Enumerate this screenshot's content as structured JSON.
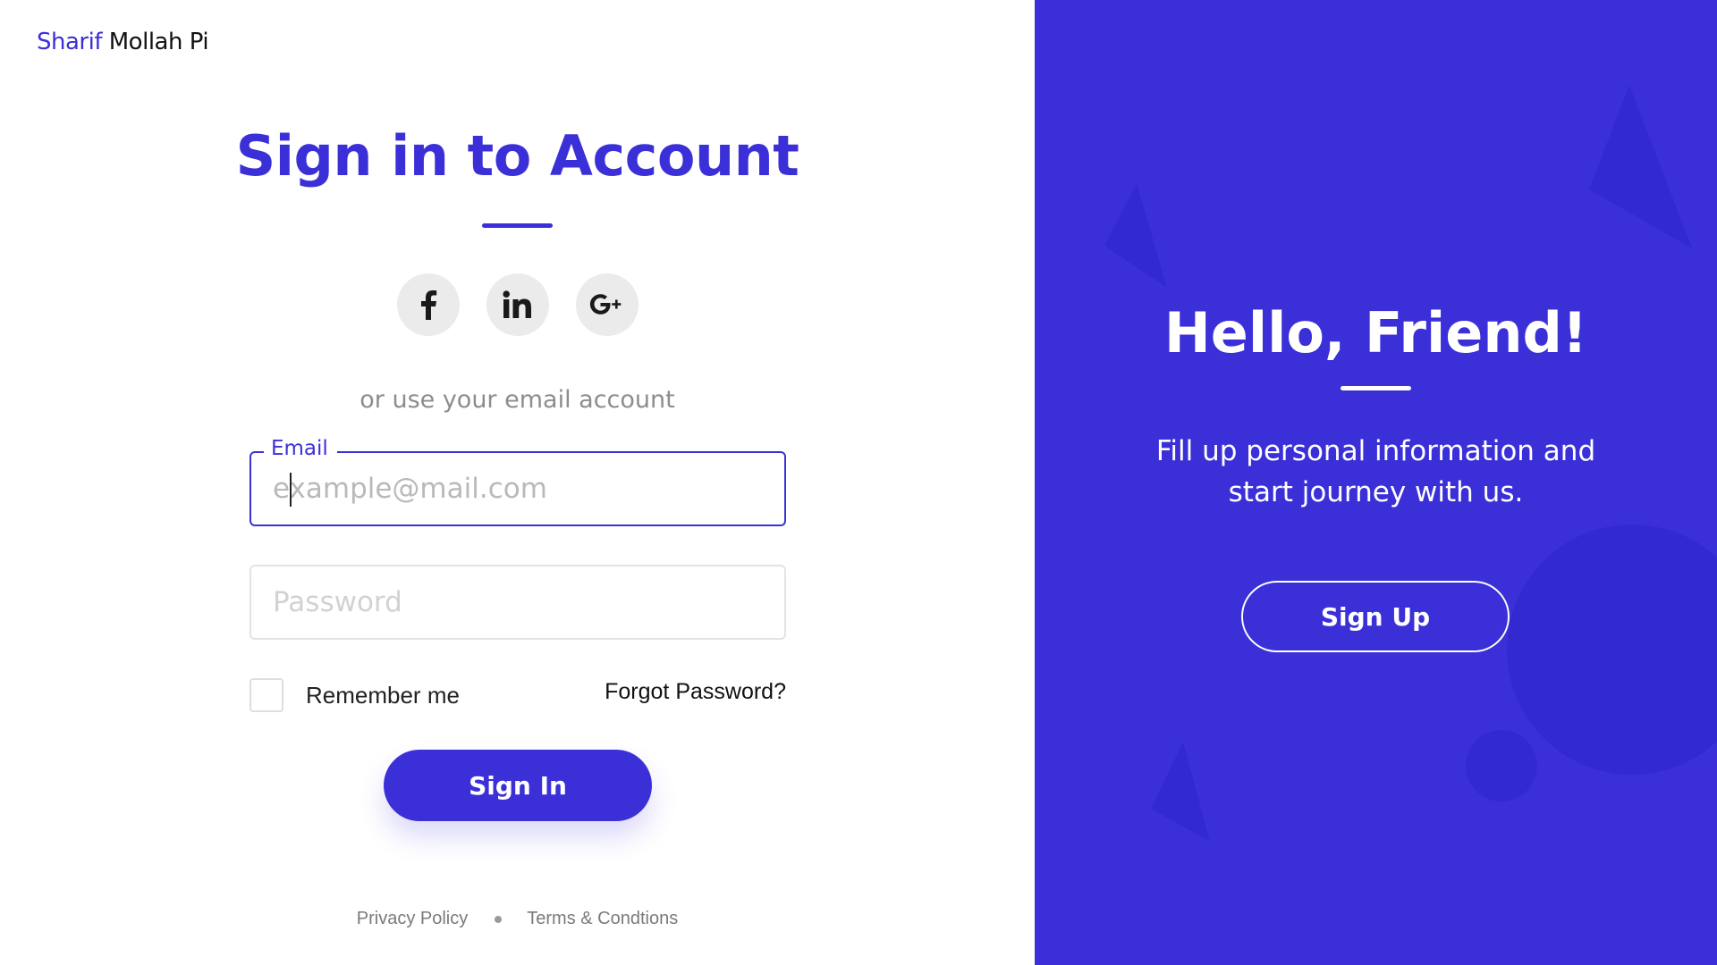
{
  "brand": {
    "first": "Sharif",
    "last": "Mollah Pi"
  },
  "signin": {
    "title": "Sign in to Account",
    "alt_text": "or use your email account",
    "email_label": "Email",
    "email_placeholder": "example@mail.com",
    "email_value": "",
    "password_placeholder": "Password",
    "password_value": "",
    "remember_label": "Remember me",
    "remember_checked": false,
    "forgot_label": "Forgot Password?",
    "button_label": "Sign In"
  },
  "social": [
    {
      "name": "facebook",
      "icon": "facebook-icon"
    },
    {
      "name": "linkedin",
      "icon": "linkedin-icon"
    },
    {
      "name": "google-plus",
      "icon": "google-plus-icon"
    }
  ],
  "footer": {
    "privacy": "Privacy Policy",
    "terms": "Terms & Condtions"
  },
  "panel": {
    "title": "Hello, Friend!",
    "text_line1": "Fill up personal information and",
    "text_line2": "start journey with us.",
    "button_label": "Sign Up"
  },
  "colors": {
    "accent": "#3b30d8",
    "social_bg": "#ebebeb",
    "muted_text": "#8d8d8d"
  }
}
